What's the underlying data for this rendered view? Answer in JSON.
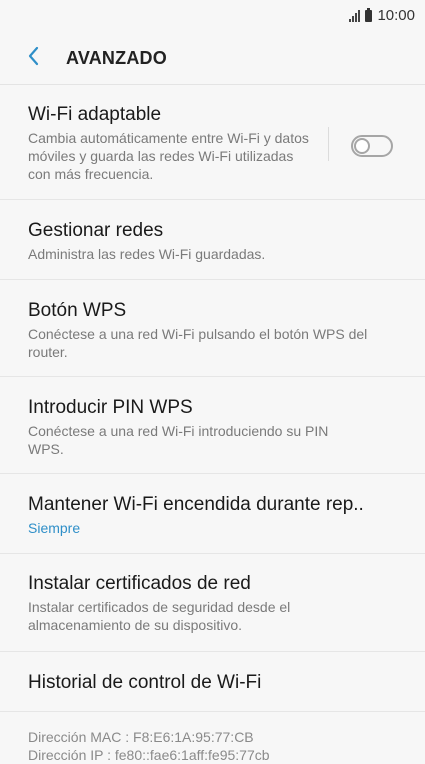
{
  "status": {
    "time": "10:00"
  },
  "app_bar": {
    "title": "AVANZADO"
  },
  "items": [
    {
      "title": "Wi-Fi adaptable",
      "subtitle": "Cambia automáticamente entre Wi-Fi y datos móviles y guarda las redes Wi-Fi utilizadas con más frecuencia.",
      "toggle": "off"
    },
    {
      "title": "Gestionar redes",
      "subtitle": "Administra las redes Wi-Fi guardadas."
    },
    {
      "title": "Botón WPS",
      "subtitle": "Conéctese a una red Wi-Fi pulsando el botón WPS del router."
    },
    {
      "title": "Introducir PIN WPS",
      "subtitle": "Conéctese a una red Wi-Fi introduciendo su PIN WPS."
    },
    {
      "title": "Mantener Wi-Fi encendida durante rep..",
      "subtitle": "Siempre"
    },
    {
      "title": "Instalar certificados de red",
      "subtitle": "Instalar certificados de seguridad desde el almacenamiento de su dispositivo."
    },
    {
      "title": "Historial de control de Wi-Fi"
    }
  ],
  "footer": {
    "mac": "Dirección MAC : F8:E6:1A:95:77:CB",
    "ip": "Dirección IP : fe80::fae6:1aff:fe95:77cb"
  },
  "colors": {
    "accent": "#2f8fc8",
    "back_arrow": "#2f8fc8"
  }
}
